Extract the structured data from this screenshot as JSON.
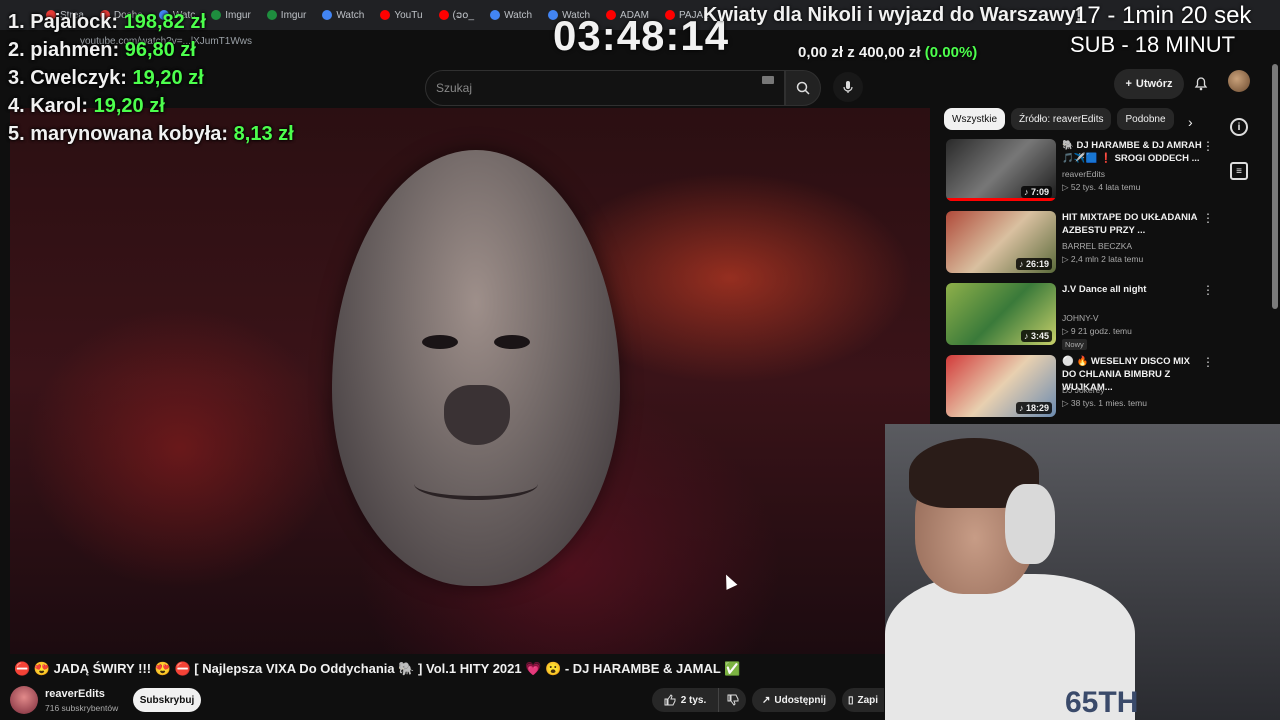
{
  "browser": {
    "tabs": [
      "Strea",
      "Dosha",
      "Watc",
      "Imgur",
      "Imgur",
      "Watch",
      "YouTu",
      "(ວ໐_",
      "Watch",
      "Watch",
      "ADAM",
      "PAJAL"
    ],
    "url": "youtube.com/watch?v=...lXJumT1Wws"
  },
  "header": {
    "search_placeholder": "Szukaj",
    "create_label": "Utwórz"
  },
  "overlay": {
    "leaderboard": [
      {
        "name": "1. Pajalock:",
        "amount": "198,82 zł"
      },
      {
        "name": "2. piahmen:",
        "amount": "96,80 zł"
      },
      {
        "name": "3. Cwelczyk:",
        "amount": "19,20 zł"
      },
      {
        "name": "4. Karol:",
        "amount": "19,20 zł"
      },
      {
        "name": "5. marynowana kobyła:",
        "amount": "8,13 zł"
      }
    ],
    "timer": "03:48:14",
    "goal_text": "0,00 zł z 400,00 zł",
    "goal_pct": "(0.00%)",
    "ticker": "Kwiaty dla Nikoli i wyjazd do Warszawy!",
    "ticker_right": "17 - 1min 20 sek",
    "sub_timer": "SUB - 18 MINUT"
  },
  "chips": [
    "Wszystkie",
    "Źródło: reaverEdits",
    "Podobne"
  ],
  "recommendations": [
    {
      "title": "🐘 DJ HARAMBE & DJ AMRAH 🎵✈️🟦 ❗ SROGI ODDECH ...",
      "channel": "reaverEdits",
      "meta": "▷ 52 tys.  4 lata temu",
      "duration": "♪ 7:09",
      "badge": ""
    },
    {
      "title": "HIT MIXTAPE DO UKŁADANIA AZBESTU PRZY ...",
      "channel": "BARREL BECZKA",
      "meta": "▷ 2,4 mln  2 lata temu",
      "duration": "♪ 26:19",
      "badge": ""
    },
    {
      "title": "J.V Dance all night",
      "channel": "JOHNY-V",
      "meta": "▷ 9  21 godz. temu",
      "duration": "♪ 3:45",
      "badge": "Nowy"
    },
    {
      "title": "⚪ 🔥 WESELNY DISCO MIX DO CHLANIA BIMBRU Z WUJKAM...",
      "channel": "DJ Jokerey",
      "meta": "▷ 38 tys.  1 mies. temu",
      "duration": "♪ 18:29",
      "badge": ""
    }
  ],
  "video": {
    "title": "⛔ 😍 JADĄ ŚWIRY !!! 😍 ⛔ [ Najlepsza VIXA Do Oddychania 🐘 ] Vol.1 HITY 2021 💗 😮 - DJ HARAMBE & JAMAL ✅",
    "channel": "reaverEdits",
    "subs": "716 subskrybentów",
    "subscribe_label": "Subskrybuj",
    "likes": "2 tys.",
    "share_label": "Udostępnij",
    "save_label": "Zapi"
  },
  "webcam": {
    "shirt_text": "65TH"
  },
  "colors": {
    "accent_green": "#4dff4d",
    "progress_red": "#ff0000"
  }
}
